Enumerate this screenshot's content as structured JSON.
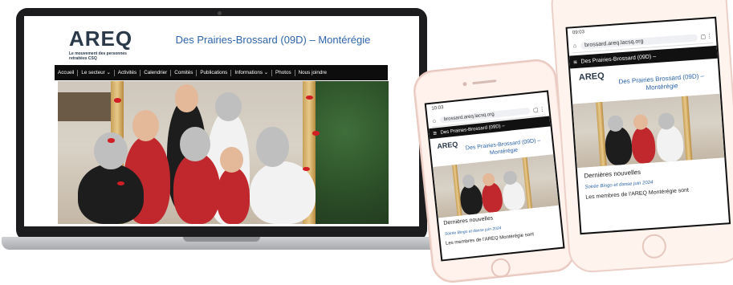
{
  "desktop": {
    "logo": {
      "mark": "AREQ",
      "tagline": "Le mouvement des personnes retraitées CSQ"
    },
    "site_title": "Des Prairies-Brossard (09D) – Montérégie",
    "nav": [
      "Accueil",
      "Le secteur ⌄",
      "Activités",
      "Calendrier",
      "Comités",
      "Publications",
      "Informations ⌄",
      "Photos",
      "Nous joindre"
    ]
  },
  "phone_small": {
    "time": "10:03",
    "url": "brossard.areq.lacsq.org",
    "nav_title": "Des Prairies-Brossard (09D) –",
    "logo": "AREQ",
    "site_title": "Des Prairies-Brossard (09D) – Montérégie",
    "section_heading": "Dernières nouvelles",
    "news_link": "Soirée Bingo et danse juin 2024",
    "news_text": "Les membres de l'AREQ Montérégie sont"
  },
  "phone_large": {
    "time": "09:03",
    "url": "brossard.areq.lacsq.org",
    "nav_title": "Des Prairies-Brossard (09D) –",
    "logo": "AREQ",
    "site_title": "Des Prairies Brossard (09D) – Montérégie",
    "section_heading": "Dernières nouvelles",
    "news_link": "Soirée Bingo et danse juin 2024",
    "news_text": "Les membres de l'AREQ Montérégie sont"
  },
  "colors": {
    "brand_blue": "#2e64a8",
    "nav_black": "#0d0d0d",
    "logo_navy": "#2b3a4a"
  }
}
